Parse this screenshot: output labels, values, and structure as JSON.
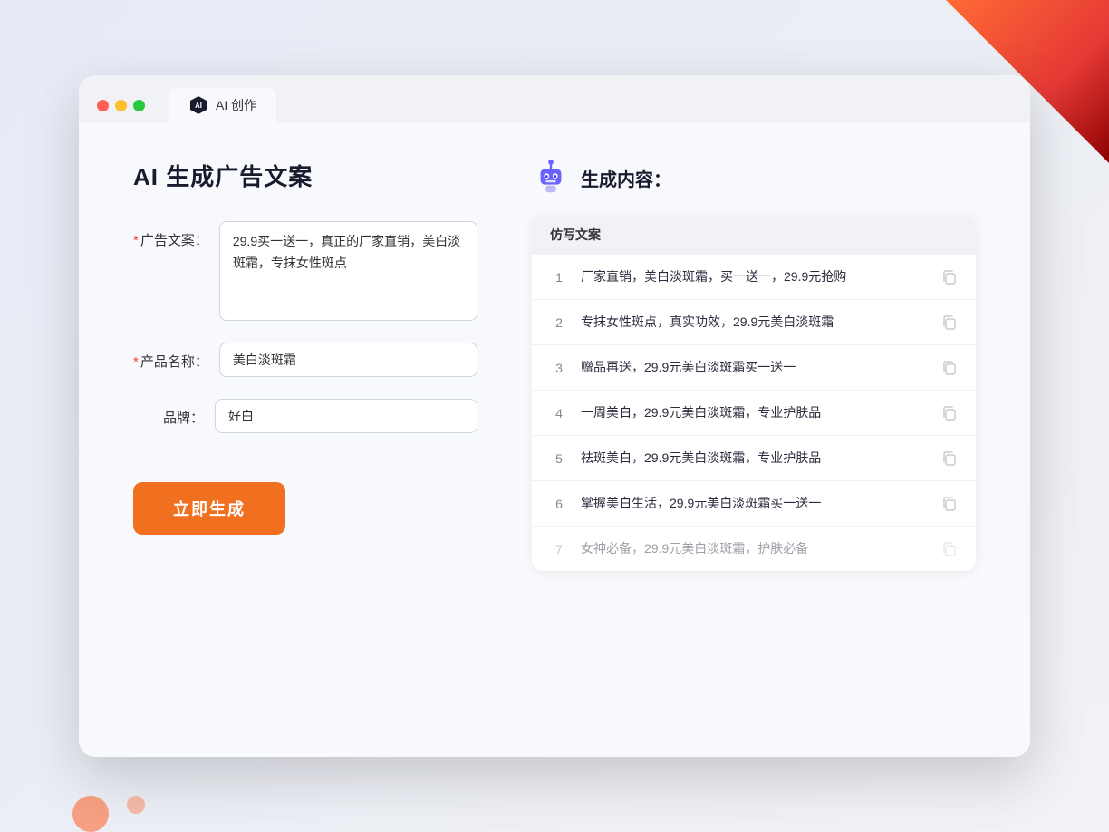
{
  "browser": {
    "tab_label": "AI 创作",
    "traffic_lights": [
      "red",
      "yellow",
      "green"
    ]
  },
  "left_panel": {
    "page_title": "AI 生成广告文案",
    "fields": [
      {
        "label": "广告文案：",
        "required": true,
        "type": "textarea",
        "value": "29.9买一送一，真正的厂家直销，美白淡斑霜，专抹女性斑点",
        "name": "ad-copy-input"
      },
      {
        "label": "产品名称：",
        "required": true,
        "type": "input",
        "value": "美白淡斑霜",
        "name": "product-name-input"
      },
      {
        "label": "品牌：",
        "required": false,
        "type": "input",
        "value": "好白",
        "name": "brand-input"
      }
    ],
    "generate_btn": "立即生成"
  },
  "right_panel": {
    "title": "生成内容：",
    "table_header": "仿写文案",
    "results": [
      {
        "num": "1",
        "text": "厂家直销，美白淡斑霜，买一送一，29.9元抢购",
        "faded": false
      },
      {
        "num": "2",
        "text": "专抹女性斑点，真实功效，29.9元美白淡斑霜",
        "faded": false
      },
      {
        "num": "3",
        "text": "赠品再送，29.9元美白淡斑霜买一送一",
        "faded": false
      },
      {
        "num": "4",
        "text": "一周美白，29.9元美白淡斑霜，专业护肤品",
        "faded": false
      },
      {
        "num": "5",
        "text": "祛斑美白，29.9元美白淡斑霜，专业护肤品",
        "faded": false
      },
      {
        "num": "6",
        "text": "掌握美白生活，29.9元美白淡斑霜买一送一",
        "faded": false
      },
      {
        "num": "7",
        "text": "女神必备，29.9元美白淡斑霜，护肤必备",
        "faded": true
      }
    ]
  },
  "colors": {
    "orange": "#f07020",
    "purple": "#5b6af0",
    "robot_head": "#6c63ff"
  }
}
